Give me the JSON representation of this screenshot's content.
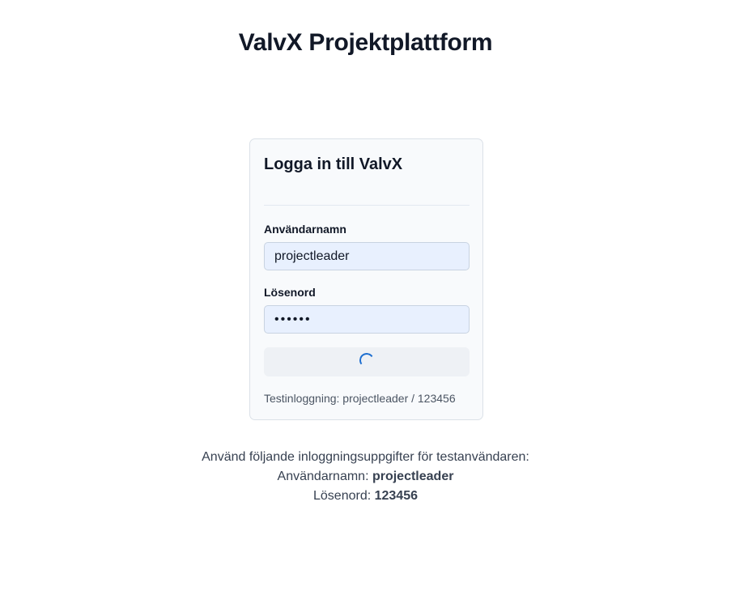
{
  "header": {
    "title": "ValvX Projektplattform"
  },
  "login": {
    "title": "Logga in till ValvX",
    "username_label": "Användarnamn",
    "username_value": "projectleader",
    "password_label": "Lösenord",
    "password_value": "123456",
    "submit_state": "loading",
    "test_hint": "Testinloggning: projectleader / 123456"
  },
  "info": {
    "intro": "Använd följande inloggningsuppgifter för testanvändaren:",
    "username_label": "Användarnamn:",
    "username_value": "projectleader",
    "password_label": "Lösenord:",
    "password_value": "123456"
  },
  "colors": {
    "accent": "#1e6fd0",
    "input_background": "#e8f0fe",
    "card_background": "#f8fafc"
  },
  "icons": {
    "loading": "spinner-icon"
  }
}
